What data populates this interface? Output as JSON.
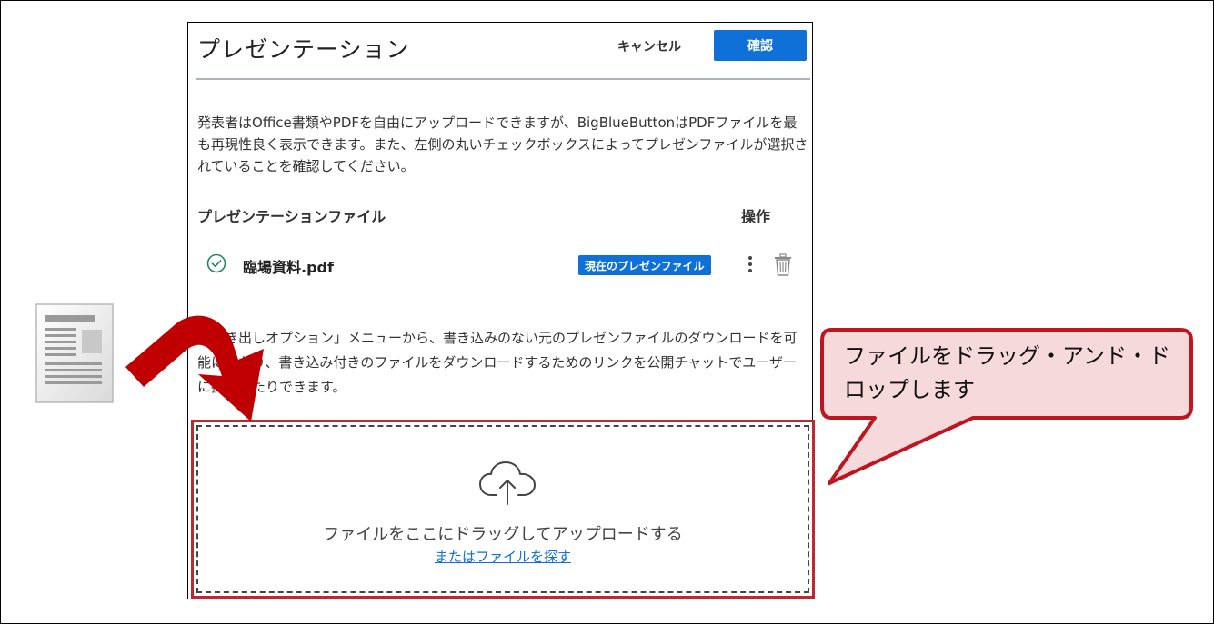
{
  "dialog": {
    "title": "プレゼンテーション",
    "cancel_label": "キャンセル",
    "confirm_label": "確認",
    "description": "発表者はOffice書類やPDFを自由にアップロードできますが、BigBlueButtonはPDFファイルを最も再現性良く表示できます。また、左側の丸いチェックボックスによってプレゼンファイルが選択されていることを確認してください。",
    "table_header_file": "プレゼンテーションファイル",
    "table_header_actions": "操作",
    "files": [
      {
        "name": "臨場資料.pdf",
        "badge": "現在のプレゼンファイル",
        "selected": true
      }
    ],
    "download_note": "「書き出しオプション」メニューから、書き込みのない元のプレゼンファイルのダウンロードを可能にしたり、書き込み付きのファイルをダウンロードするためのリンクを公開チャットでユーザーに提供したりできます。",
    "drop_zone": {
      "text": "ファイルをここにドラッグしてアップロードする",
      "browse_link": "またはファイルを探す"
    }
  },
  "callout": {
    "text": "ファイルをドラッグ・アンド・ドロップします"
  },
  "colors": {
    "accent": "#0f70d7",
    "highlight_red": "#c0282f",
    "callout_fill": "#f6dadb"
  },
  "icons": [
    "check-circle-icon",
    "more-vertical-icon",
    "trash-icon",
    "cloud-upload-icon",
    "document-icon",
    "curved-arrow-icon"
  ]
}
